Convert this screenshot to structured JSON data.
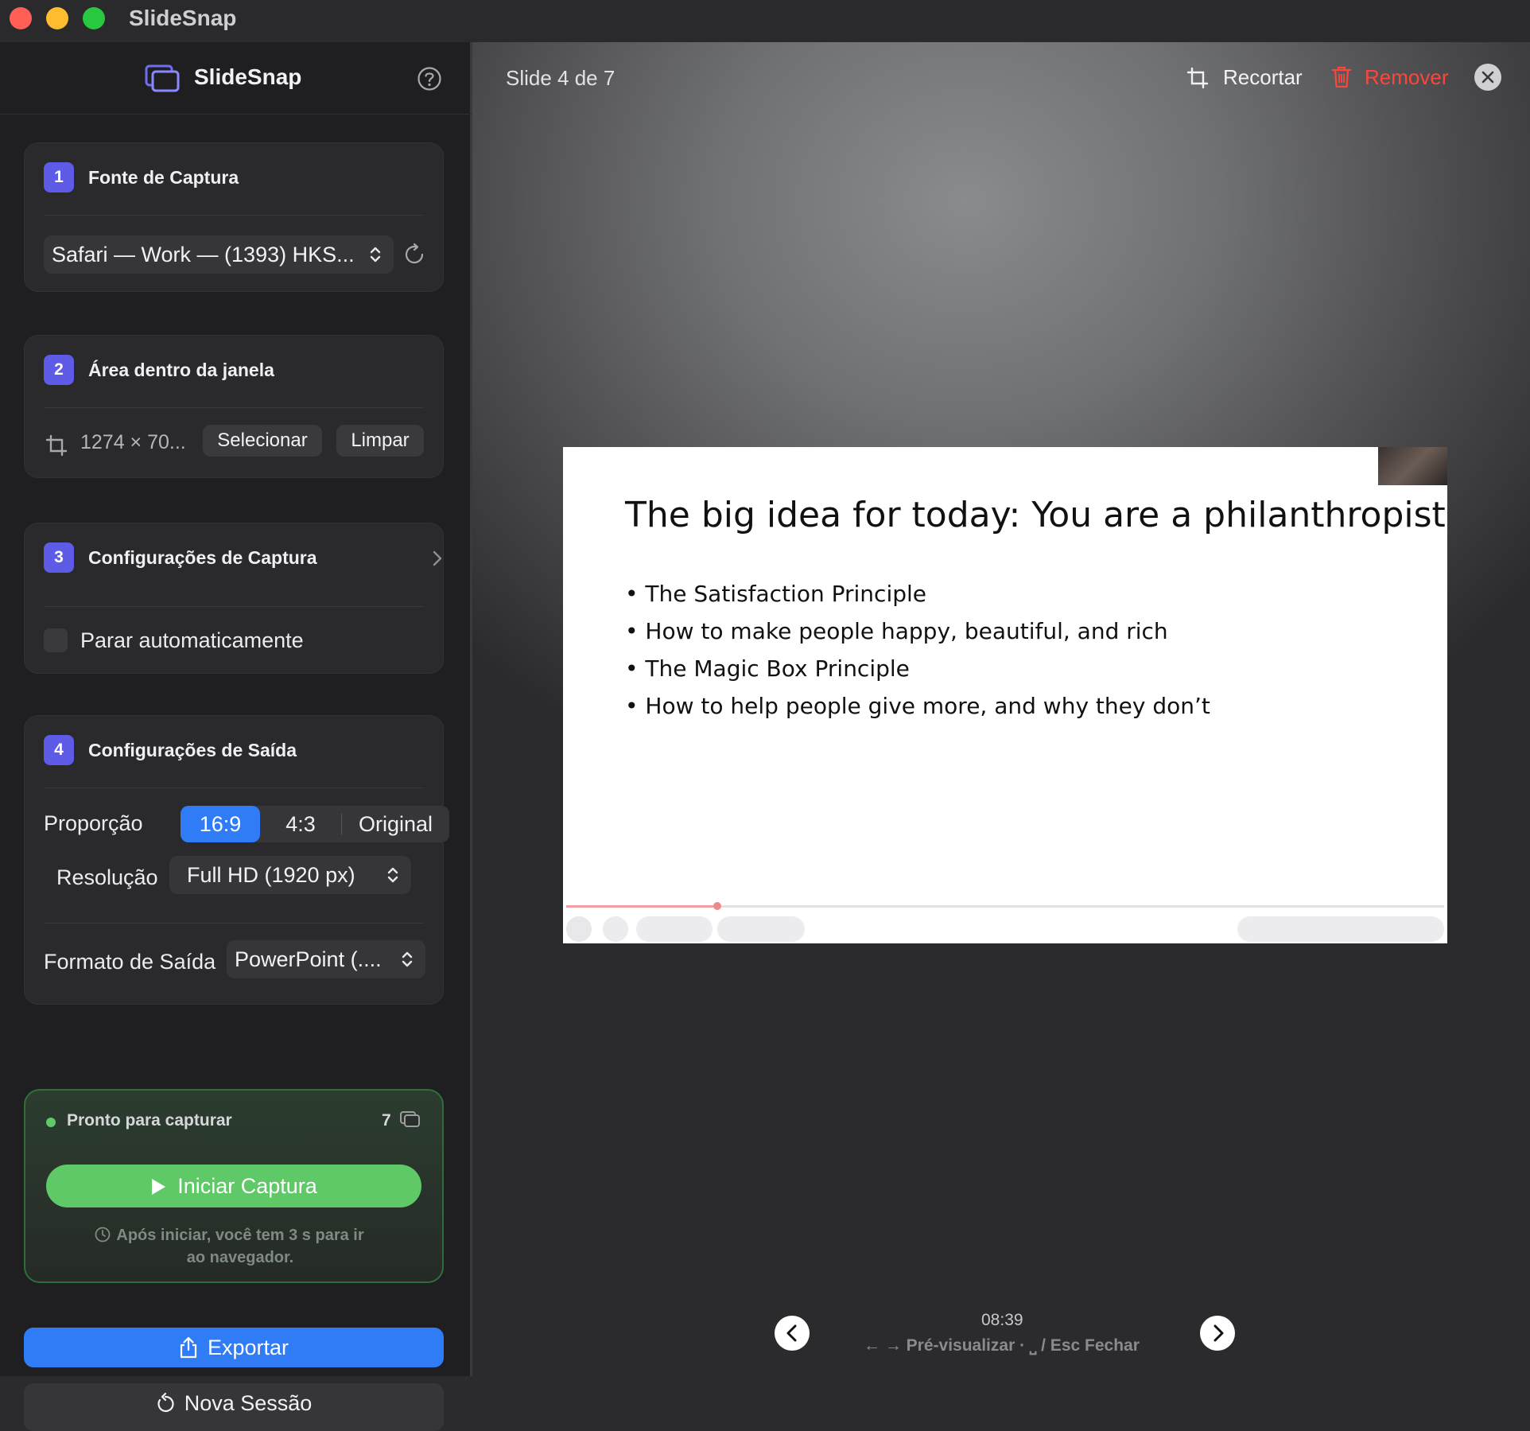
{
  "window": {
    "app_title": "SlideSnap"
  },
  "sidebar": {
    "brand": "SlideSnap",
    "capture_source": {
      "step": "1",
      "title": "Fonte de Captura",
      "selected": "Safari — Work — (1393) HKS..."
    },
    "area": {
      "step": "2",
      "title": "Área dentro da janela",
      "size": "1274 × 70...",
      "select_label": "Selecionar",
      "clear_label": "Limpar"
    },
    "capture_settings": {
      "step": "3",
      "title": "Configurações de Captura",
      "auto_stop_label": "Parar automaticamente",
      "auto_stop_checked": false
    },
    "output_settings": {
      "step": "4",
      "title": "Configurações de Saída",
      "ratio_label": "Proporção",
      "ratio_options": [
        "16:9",
        "4:3",
        "Original"
      ],
      "ratio_selected": "16:9",
      "resolution_label": "Resolução",
      "resolution_value": "Full HD (1920 px)",
      "format_label": "Formato de Saída",
      "format_value": "PowerPoint (...."
    },
    "capture_status": {
      "status_text": "Pronto para capturar",
      "slide_count": "7",
      "start_label": "Iniciar Captura",
      "hint": "Após iniciar, você tem 3 s para ir ao navegador."
    },
    "export_label": "Exportar",
    "new_session_label": "Nova Sessão"
  },
  "preview": {
    "slide_indicator": "Slide 4 de 7",
    "crop_label": "Recortar",
    "remove_label": "Remover",
    "slide": {
      "title": "The big idea for today: You are a philanthropist",
      "bullets": [
        "• The Satisfaction Principle",
        "• How to make people happy, beautiful, and rich",
        "• The Magic Box Principle",
        "• How to help people give more, and why they don’t"
      ]
    },
    "timestamp": "08:39",
    "shortcuts": "← → Pré-visualizar · ⎵ / Esc Fechar"
  },
  "colors": {
    "accent_purple": "#5e5ce6",
    "accent_blue": "#2f7cf6",
    "accent_green": "#5fc867",
    "danger_red": "#ff453a"
  }
}
